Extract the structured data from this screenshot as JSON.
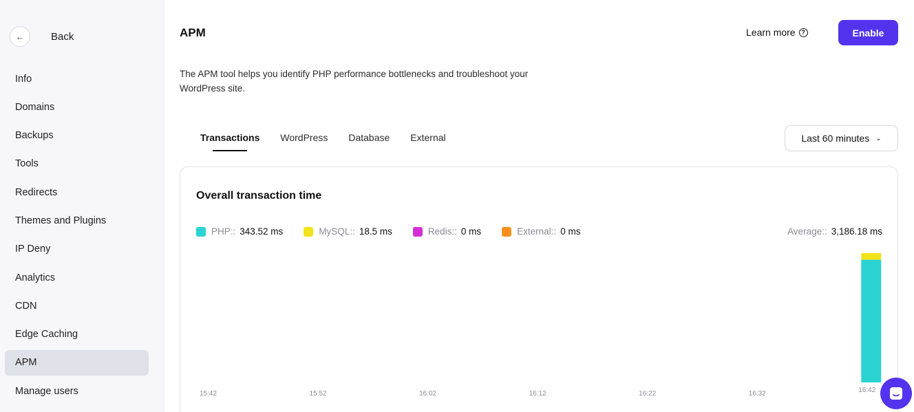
{
  "sidebar": {
    "back_label": "Back",
    "items": [
      {
        "label": "Info"
      },
      {
        "label": "Domains"
      },
      {
        "label": "Backups"
      },
      {
        "label": "Tools"
      },
      {
        "label": "Redirects"
      },
      {
        "label": "Themes and Plugins"
      },
      {
        "label": "IP Deny"
      },
      {
        "label": "Analytics"
      },
      {
        "label": "CDN"
      },
      {
        "label": "Edge Caching"
      },
      {
        "label": "APM",
        "active": true
      },
      {
        "label": "Manage users"
      }
    ]
  },
  "header": {
    "title": "APM",
    "learn_more": "Learn more",
    "enable_label": "Enable",
    "accent_color": "#5333ed"
  },
  "description": "The APM tool helps you identify PHP performance bottlenecks and troubleshoot your WordPress site.",
  "tabs": [
    {
      "label": "Transactions",
      "active": true
    },
    {
      "label": "WordPress"
    },
    {
      "label": "Database"
    },
    {
      "label": "External"
    }
  ],
  "time_range": {
    "selected": "Last 60 minutes"
  },
  "card": {
    "title": "Overall transaction time",
    "legend": [
      {
        "label": "PHP::",
        "value": "343.52 ms",
        "color": "#2bd3d3"
      },
      {
        "label": "MySQL::",
        "value": "18.5 ms",
        "color": "#f2e21a"
      },
      {
        "label": "Redis::",
        "value": "0 ms",
        "color": "#d42fd6"
      },
      {
        "label": "External::",
        "value": "0 ms",
        "color": "#f7901e"
      }
    ],
    "average_label": "Average::",
    "average_value": "3,186.18 ms"
  },
  "chart_data": {
    "type": "bar",
    "stacked": true,
    "title": "Overall transaction time",
    "categories": [
      "15:42",
      "15:52",
      "16:02",
      "16:12",
      "16:22",
      "16:32",
      "16:42"
    ],
    "series": [
      {
        "name": "PHP",
        "values": [
          0,
          0,
          0,
          0,
          0,
          0,
          343.52
        ],
        "color": "#2bd3d3"
      },
      {
        "name": "MySQL",
        "values": [
          0,
          0,
          0,
          0,
          0,
          0,
          18.5
        ],
        "color": "#f2e21a"
      },
      {
        "name": "Redis",
        "values": [
          0,
          0,
          0,
          0,
          0,
          0,
          0
        ],
        "color": "#d42fd6"
      },
      {
        "name": "External",
        "values": [
          0,
          0,
          0,
          0,
          0,
          0,
          0
        ],
        "color": "#f7901e"
      }
    ],
    "legend_position": "top-left",
    "grid": false
  },
  "chat": {
    "icon": "chat-icon"
  }
}
